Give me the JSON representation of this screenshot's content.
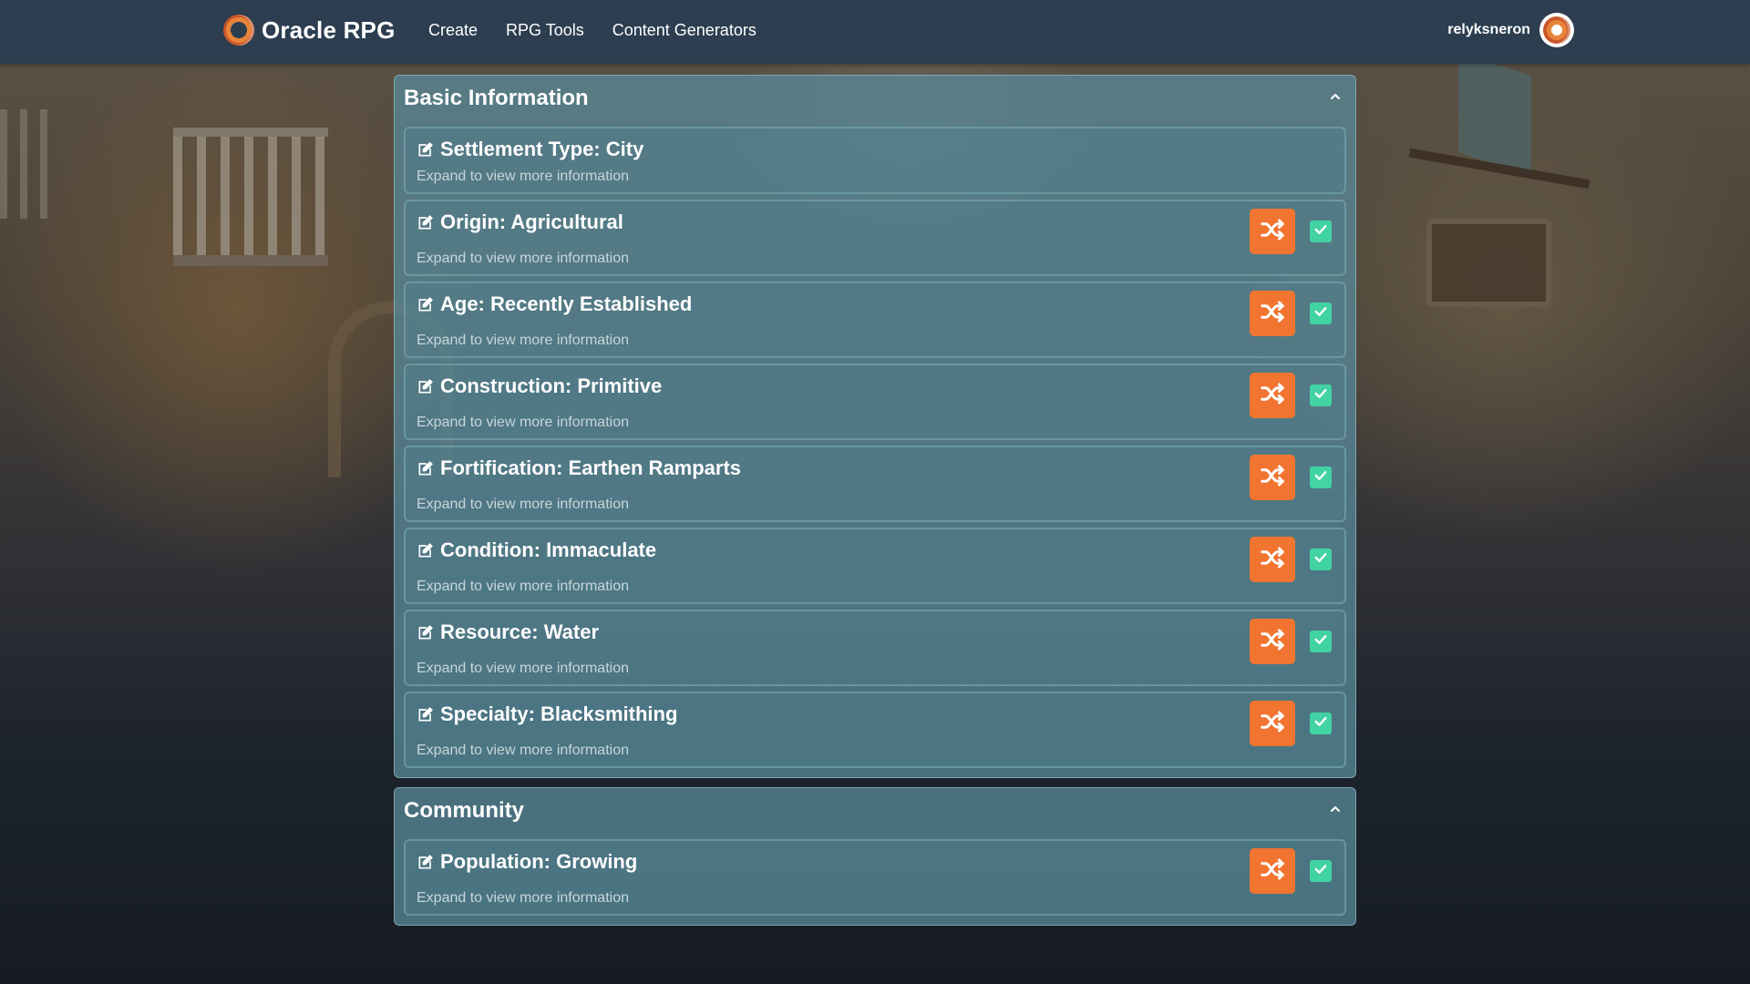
{
  "nav": {
    "brand": "Oracle RPG",
    "links": [
      "Create",
      "RPG Tools",
      "Content Generators"
    ],
    "username": "relyksneron"
  },
  "sections": [
    {
      "title": "Basic Information",
      "items": [
        {
          "label": "Settlement Type: City",
          "subtitle": "Expand to view more information"
        },
        {
          "label": "Origin: Agricultural",
          "subtitle": "Expand to view more information"
        },
        {
          "label": "Age: Recently Established",
          "subtitle": "Expand to view more information"
        },
        {
          "label": "Construction: Primitive",
          "subtitle": "Expand to view more information"
        },
        {
          "label": "Fortification: Earthen Ramparts",
          "subtitle": "Expand to view more information"
        },
        {
          "label": "Condition: Immaculate",
          "subtitle": "Expand to view more information"
        },
        {
          "label": "Resource: Water",
          "subtitle": "Expand to view more information"
        },
        {
          "label": "Specialty: Blacksmithing",
          "subtitle": "Expand to view more information"
        }
      ]
    },
    {
      "title": "Community",
      "items": [
        {
          "label": "Population: Growing",
          "subtitle": "Expand to view more information"
        }
      ]
    }
  ],
  "colors": {
    "navbar": "#2c3e50",
    "shuffle_button": "#f17530",
    "checkbox": "#42d3a4",
    "panel": "#578696"
  },
  "icons": {
    "edit": "edit-icon",
    "shuffle": "shuffle-icon",
    "check": "checkbox-checked-icon",
    "collapse": "chevron-up-icon"
  }
}
